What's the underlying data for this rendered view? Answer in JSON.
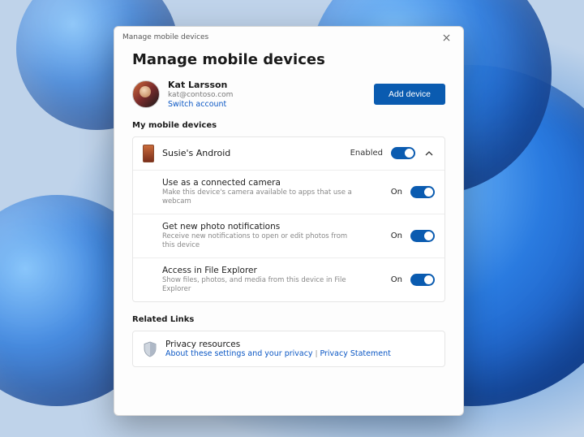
{
  "window": {
    "title": "Manage mobile devices"
  },
  "page": {
    "heading": "Manage mobile devices"
  },
  "user": {
    "name": "Kat Larsson",
    "email": "kat@contoso.com",
    "switch_label": "Switch account"
  },
  "actions": {
    "add_device": "Add device"
  },
  "sections": {
    "devices_label": "My mobile devices",
    "related_label": "Related Links"
  },
  "device": {
    "name": "Susie's Android",
    "state": "Enabled",
    "settings": [
      {
        "title": "Use as a connected camera",
        "desc": "Make this device's camera available to apps that use a webcam",
        "state": "On"
      },
      {
        "title": "Get new photo notifications",
        "desc": "Receive new notifications to open or edit photos from this device",
        "state": "On"
      },
      {
        "title": "Access in File Explorer",
        "desc": "Show files, photos, and media from this device in File Explorer",
        "state": "On"
      }
    ]
  },
  "privacy": {
    "title": "Privacy resources",
    "link1": "About these settings and your privacy",
    "link2": "Privacy Statement"
  }
}
